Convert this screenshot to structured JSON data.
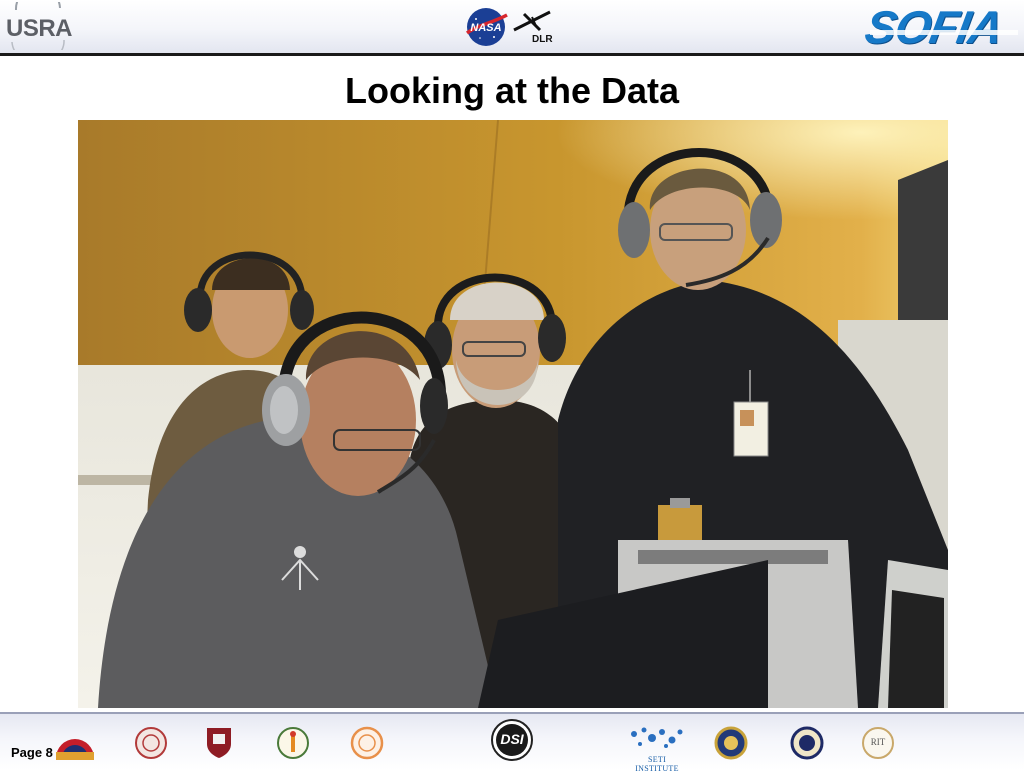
{
  "header": {
    "left_logo_text": "USRA",
    "center_logo_dlr_text": "DLR",
    "right_logo_text": "SOFIA",
    "nasa_logo": "nasa-meatball-icon",
    "dlr_logo": "dlr-cross-icon"
  },
  "slide": {
    "title": "Looking at the Data",
    "photo": "four-men-with-headsets-at-monitors-photo"
  },
  "footer": {
    "page_label": "Page 8",
    "logos": [
      "lowell-observatory-logo",
      "cornell-seal-logo",
      "chicago-shield-logo",
      "wreath-seal-logo",
      "orange-seal-logo",
      "dsi-logo",
      "seti-institute-logo",
      "gold-seal-logo",
      "navy-seal-logo",
      "rit-seal-logo"
    ],
    "dsi_text": "DSI",
    "seti_text": "SETI INSTITUTE",
    "rit_text": "RIT"
  },
  "colors": {
    "sofia_blue": "#1679c8",
    "header_rule": "#1a1a1a",
    "wall_gold": "#c8962e"
  }
}
